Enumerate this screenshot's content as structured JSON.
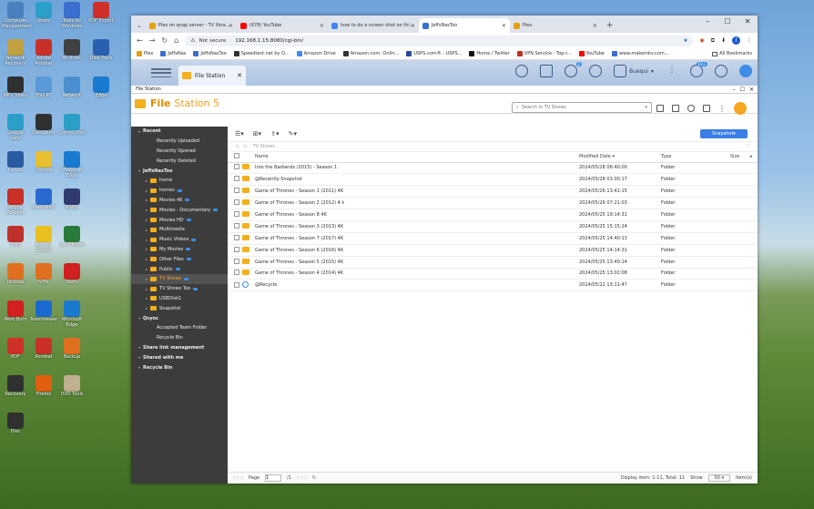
{
  "desktop_icons": [
    {
      "label": "Computer Management",
      "color": "#4a7fc0"
    },
    {
      "label": "Steps",
      "color": "#2aa0c8"
    },
    {
      "label": "Tools for Windows",
      "color": "#3a6fd0"
    },
    {
      "label": "PDF Export",
      "color": "#d0302a"
    },
    {
      "label": "Network Recovery",
      "color": "#c0a040"
    },
    {
      "label": "Adobe Acrobat",
      "color": "#c83028"
    },
    {
      "label": "4K Video",
      "color": "#404040"
    },
    {
      "label": "Disk Tools",
      "color": "#2a60b0"
    },
    {
      "label": "MKV Video",
      "color": "#303030"
    },
    {
      "label": "This PC",
      "color": "#5a9ad8"
    },
    {
      "label": "Network",
      "color": "#4a90d0"
    },
    {
      "label": "Edge",
      "color": "#1a7ad0"
    },
    {
      "label": "Google Lens",
      "color": "#2aa0c8"
    },
    {
      "label": "Calculator",
      "color": "#303030"
    },
    {
      "label": "Control Pad",
      "color": "#2aa0c8"
    },
    {
      "label": "Firefox",
      "color": "#e06010"
    },
    {
      "label": "Canon",
      "color": "#2a5aa0"
    },
    {
      "label": "Chrome",
      "color": "#e8c030"
    },
    {
      "label": "Microsoft Edge",
      "color": "#1a7ad0"
    },
    {
      "label": "Mozilla Firefox",
      "color": "#e06010"
    },
    {
      "label": "Adobe Acrobat",
      "color": "#c83028"
    },
    {
      "label": "MakeMKV",
      "color": "#2a6ad0"
    },
    {
      "label": "ASUS",
      "color": "#303a70"
    },
    {
      "label": "LightShot",
      "color": "#505050"
    },
    {
      "label": "Tools",
      "color": "#c0302a"
    },
    {
      "label": "Norton Secure",
      "color": "#e8c020"
    },
    {
      "label": "Land Rover",
      "color": "#2a7a3a"
    },
    {
      "label": "My Computer",
      "color": "#d0302a"
    },
    {
      "label": "Utilities",
      "color": "#e07020"
    },
    {
      "label": "VPN",
      "color": "#e07020"
    },
    {
      "label": "Nero",
      "color": "#d02020"
    },
    {
      "label": "Firefox",
      "color": "#e06010"
    },
    {
      "label": "Nero Burn",
      "color": "#d02020"
    },
    {
      "label": "TeamViewer",
      "color": "#1a6ad0"
    },
    {
      "label": "Microsoft Edge",
      "color": "#1a7ad0"
    },
    {
      "label": "Security",
      "color": "#e8c030"
    },
    {
      "label": "PDF",
      "color": "#d0302a"
    },
    {
      "label": "Acrobat",
      "color": "#c83028"
    },
    {
      "label": "Backup",
      "color": "#e07020"
    },
    {
      "label": "Maps",
      "color": "#40a0d0"
    },
    {
      "label": "Recovery",
      "color": "#303030"
    },
    {
      "label": "Firefox",
      "color": "#e06010"
    },
    {
      "label": "DVD Tools",
      "color": "#c0b090"
    },
    {
      "label": "Printer",
      "color": "#606060"
    },
    {
      "label": "Disc",
      "color": "#303030"
    }
  ],
  "browser": {
    "tabs": [
      {
        "title": "Plex on qnap server - TV libra...",
        "color": "#e5a00d"
      },
      {
        "title": "(678) YouTube",
        "color": "#ff0000"
      },
      {
        "title": "how to do a screen shot on thi...",
        "color": "#4285f4"
      },
      {
        "title": "JeffsNasToo",
        "color": "#3a6fd0",
        "active": true
      },
      {
        "title": "Plex",
        "color": "#e5a00d"
      }
    ],
    "new_tab": "+",
    "security": "Not secure",
    "url": "192.168.1.15:8080/cgi-bin/",
    "profile": "J",
    "bookmarks": [
      "Plex",
      "JeffsNas",
      "JeffsNasToo",
      "Speedtest.net by O...",
      "Amazon Drive",
      "Amazon.com: Onlin...",
      "USPS.com® - USPS...",
      "Home / Twitter",
      "VPN Service - Top-r...",
      "YouTube",
      "www.makemkv.com..."
    ],
    "all_bookmarks": "All Bookmarks"
  },
  "qts": {
    "app_tab": "File Station",
    "user": "Buequi",
    "badge_count_1": "2",
    "badge_count_2": "10+"
  },
  "window": {
    "title": "File Station",
    "app_name_bold": "File",
    "app_name_rest": "Station 5",
    "search_placeholder": "Search in TV Shows",
    "snapshot_label": "Snapshot",
    "breadcrumb": "TV Shows"
  },
  "sidebar": [
    {
      "type": "sec",
      "label": "Recent"
    },
    {
      "type": "item",
      "label": "Recently Uploaded"
    },
    {
      "type": "item",
      "label": "Recently Opened"
    },
    {
      "type": "item",
      "label": "Recently Deleted"
    },
    {
      "type": "sec",
      "label": "JeffsNasToo"
    },
    {
      "type": "folder",
      "label": "home"
    },
    {
      "type": "folder",
      "label": "homes",
      "tag": true
    },
    {
      "type": "folder",
      "label": "Movies 4K",
      "tag": true
    },
    {
      "type": "folder",
      "label": "Movies - Documentary",
      "tag": true
    },
    {
      "type": "folder",
      "label": "Movies HD",
      "tag": true
    },
    {
      "type": "folder",
      "label": "Multimedia"
    },
    {
      "type": "folder",
      "label": "Music Videos",
      "tag": true
    },
    {
      "type": "folder",
      "label": "My Movies",
      "tag": true
    },
    {
      "type": "folder",
      "label": "Other Files",
      "tag": true
    },
    {
      "type": "folder",
      "label": "Public",
      "tag": true
    },
    {
      "type": "folder",
      "label": "TV Shows",
      "tag": true,
      "selected": true
    },
    {
      "type": "folder",
      "label": "TV Shows Too",
      "tag": true
    },
    {
      "type": "folder",
      "label": "USBDisk1"
    },
    {
      "type": "folder",
      "label": "Snapshot"
    },
    {
      "type": "sec",
      "label": "Qsync"
    },
    {
      "type": "item",
      "label": "Accepted Team Folder"
    },
    {
      "type": "item",
      "label": "Recycle Bin"
    },
    {
      "type": "sec",
      "label": "Share link management"
    },
    {
      "type": "sec",
      "label": "Shared with me"
    },
    {
      "type": "sec",
      "label": "Recycle Bin"
    }
  ],
  "columns": {
    "name": "Name",
    "modified": "Modified Date",
    "type": "Type",
    "size": "Size"
  },
  "files": [
    {
      "name": "Into the Badlands (2015) - Season 1",
      "modified": "2024/05/28 06:40:00",
      "type": "Folder",
      "icon": "folder"
    },
    {
      "name": "@Recently-Snapshot",
      "modified": "2024/05/28 01:00:17",
      "type": "Folder",
      "icon": "folder"
    },
    {
      "name": "Game of Thrones - Season 1 (2011) 4K",
      "modified": "2024/05/26 13:41:15",
      "type": "Folder",
      "icon": "folder"
    },
    {
      "name": "Game of Thrones - Season 2 (2012) 4 k",
      "modified": "2024/05/26 07:21:03",
      "type": "Folder",
      "icon": "folder"
    },
    {
      "name": "Game of Thrones - Season 8 4K",
      "modified": "2024/05/25 19:14:31",
      "type": "Folder",
      "icon": "folder"
    },
    {
      "name": "Game of Thrones - Season 3 (2013) 4K",
      "modified": "2024/05/25 15:15:24",
      "type": "Folder",
      "icon": "folder"
    },
    {
      "name": "Game of Thrones - Season 7 (2017) 4K",
      "modified": "2024/05/25 14:40:13",
      "type": "Folder",
      "icon": "folder"
    },
    {
      "name": "Game of Thrones - Season 6 (2016) 4K",
      "modified": "2024/05/25 14:14:31",
      "type": "Folder",
      "icon": "folder"
    },
    {
      "name": "Game of Thrones - Season 5 (2015) 4K",
      "modified": "2024/05/25 13:40:14",
      "type": "Folder",
      "icon": "folder"
    },
    {
      "name": "Game of Thrones - Season 4 (2014) 4K",
      "modified": "2024/05/25 13:02:08",
      "type": "Folder",
      "icon": "folder"
    },
    {
      "name": "@Recycle",
      "modified": "2024/05/22 13:11:47",
      "type": "Folder",
      "icon": "recycle"
    }
  ],
  "footer": {
    "page_label": "Page",
    "page": "1",
    "of": "/1",
    "display": "Display item: 1-11, Total: 11",
    "show": "Show",
    "per_page": "50",
    "items": "Item(s)"
  }
}
